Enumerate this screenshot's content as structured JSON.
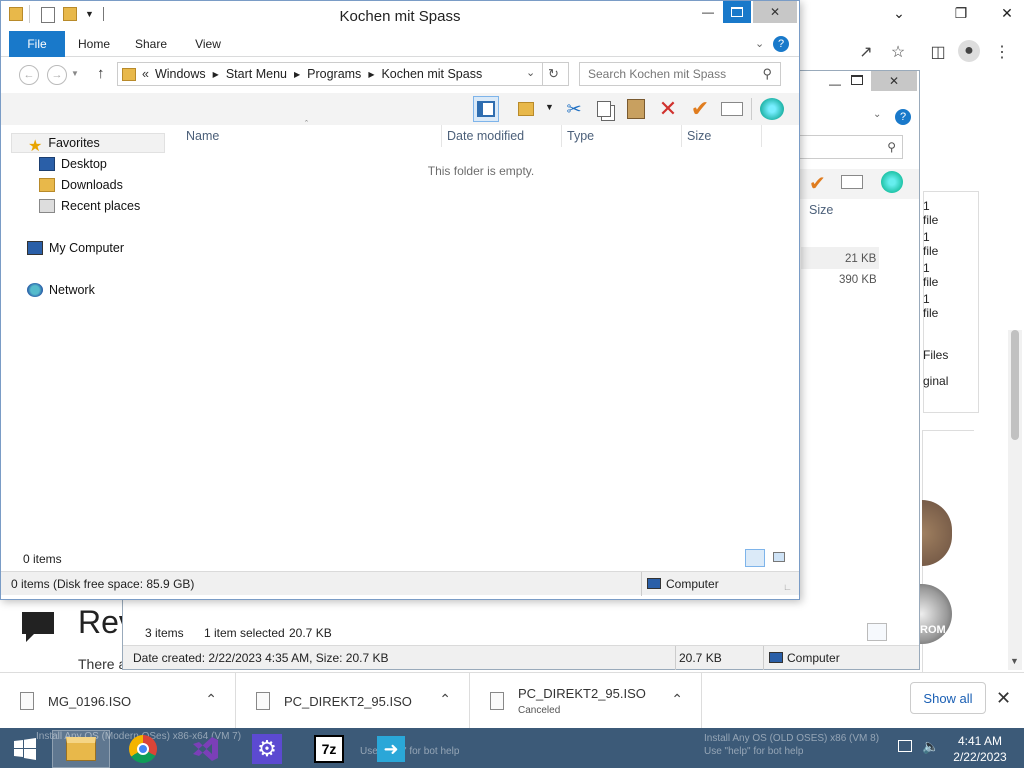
{
  "browser": {
    "page_heading": "Rev",
    "page_paragraph": "There a"
  },
  "back_window": {
    "column_size": "Size",
    "sizes": [
      "21 KB",
      "390 KB"
    ],
    "right_labels": [
      "1 file",
      "1 file",
      "1 file",
      "1 file",
      "Files",
      "ginal"
    ],
    "status_items": "3 items",
    "status_selected": "1 item selected",
    "status_selected_size": "20.7 KB",
    "details": "Date created: 2/22/2023 4:35 AM, Size: 20.7 KB",
    "details_size": "20.7 KB",
    "details_location": "Computer",
    "disc_label": "ROM"
  },
  "explorer": {
    "title": "Kochen mit Spass",
    "ribbon_tabs": [
      "File",
      "Home",
      "Share",
      "View"
    ],
    "breadcrumb": [
      "Windows",
      "Start Menu",
      "Programs",
      "Kochen mit Spass"
    ],
    "breadcrumb_prefix": "«",
    "search_placeholder": "Search Kochen mit Spass",
    "nav": {
      "favorites": "Favorites",
      "desktop": "Desktop",
      "downloads": "Downloads",
      "recent": "Recent places",
      "computer": "My Computer",
      "network": "Network"
    },
    "columns": [
      "Name",
      "Date modified",
      "Type",
      "Size"
    ],
    "empty_message": "This folder is empty.",
    "item_count": "0 items",
    "status_text": "0 items (Disk free space: 85.9 GB)",
    "status_location": "Computer"
  },
  "downloads": {
    "items": [
      {
        "name": "MG_0196.ISO",
        "sub": ""
      },
      {
        "name": "PC_DIREKT2_95.ISO",
        "sub": ""
      },
      {
        "name": "PC_DIREKT2_95.ISO",
        "sub": "Canceled"
      }
    ],
    "show_all": "Show all"
  },
  "taskbar": {
    "time": "4:41 AM",
    "date": "2/22/2023",
    "watermark_left": "Install Any OS (Modern OSes) x86-x64 (VM 7)",
    "watermark_left_sub": "Use \"help\" for bot help",
    "watermark_right": "Install Any OS (OLD OSES) x86 (VM 8)",
    "watermark_right_sub": "Use \"help\" for bot help",
    "sevenzip_label": "7z"
  },
  "colors": {
    "accent": "#1979ca",
    "taskbar": "#3c5a78",
    "link": "#1a5fb4"
  }
}
